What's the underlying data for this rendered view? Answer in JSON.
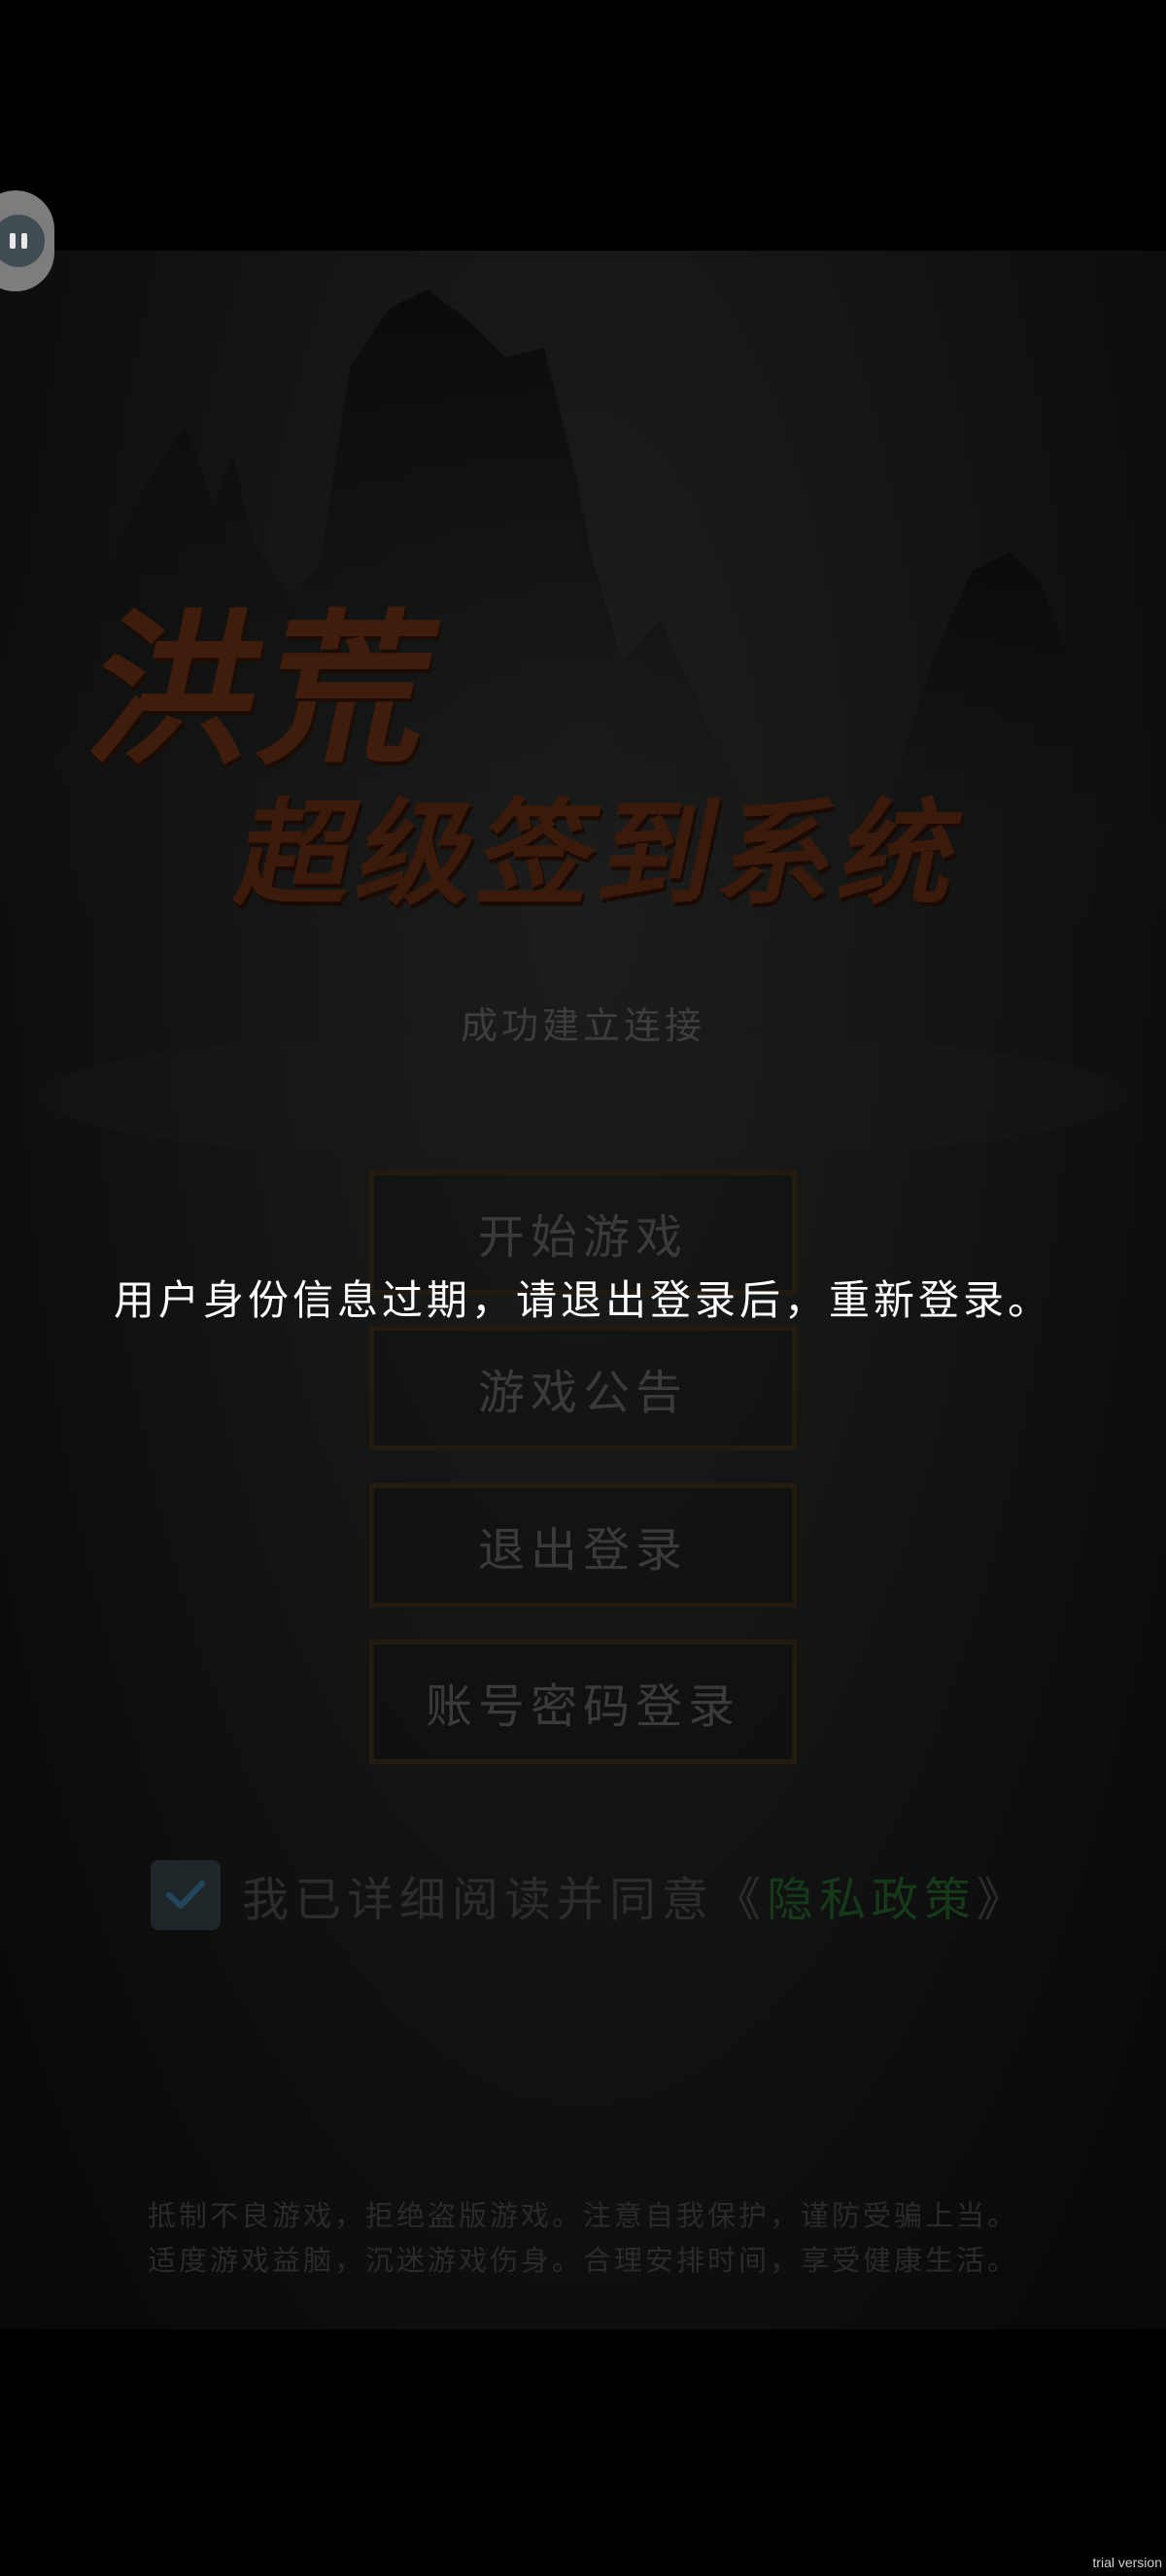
{
  "logo": {
    "line1": "洪荒",
    "line2": "超级签到系统"
  },
  "status_text": "成功建立连接",
  "menu": {
    "start": "开始游戏",
    "notice": "游戏公告",
    "logout": "退出登录",
    "account_login": "账号密码登录"
  },
  "agreement": {
    "checked": true,
    "prefix": "我已详细阅读并同意《",
    "link": "隐私政策",
    "suffix": "》"
  },
  "health_notice": {
    "line1": "抵制不良游戏，拒绝盗版游戏。注意自我保护，谨防受骗上当。",
    "line2": "适度游戏益脑，沉迷游戏伤身。合理安排时间，享受健康生活。"
  },
  "toast": "用户身份信息过期，请退出登录后，重新登录。",
  "watermark": "trial version",
  "colors": {
    "background": "#000000",
    "logo": "#3f1d0c",
    "button_border": "#231a10",
    "privacy_link": "#16391a",
    "toast_text": "#ffffff"
  },
  "icons": {
    "side_handle": "float-menu-icon",
    "checkbox": "checkmark-icon"
  }
}
